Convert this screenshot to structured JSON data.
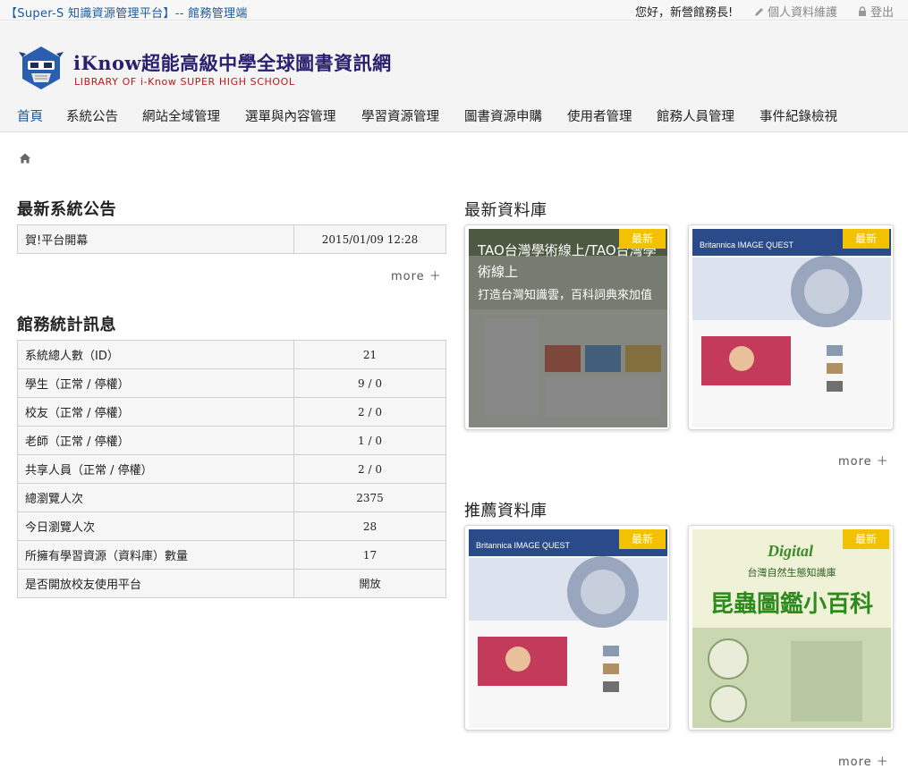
{
  "topbar": {
    "platform": "【Super-S 知識資源管理平台】-- 館務管理端",
    "greeting": "您好，新營館務長!",
    "profile_link": "個人資料維護",
    "logout_link": "登出"
  },
  "header": {
    "title": "iKnow超能高級中學全球圖書資訊網",
    "subtitle": "LIBRARY OF i-Know SUPER HIGH SCHOOL"
  },
  "nav": {
    "items": [
      "首頁",
      "系統公告",
      "網站全域管理",
      "選單與內容管理",
      "學習資源管理",
      "圖書資源申購",
      "使用者管理",
      "館務人員管理",
      "事件紀錄檢視"
    ],
    "active": "首頁"
  },
  "announcements": {
    "title": "最新系統公告",
    "rows": [
      {
        "label": "賀!平台開幕",
        "value": "2015/01/09 12:28"
      }
    ],
    "more": "more ＋"
  },
  "stats": {
    "title": "館務統計訊息",
    "rows": [
      {
        "label": "系統總人數（ID）",
        "value": "21"
      },
      {
        "label": "學生（正常 / 停權）",
        "value": "9 / 0"
      },
      {
        "label": "校友（正常 / 停權）",
        "value": "2 / 0"
      },
      {
        "label": "老師（正常 / 停權）",
        "value": "1 / 0"
      },
      {
        "label": "共享人員（正常 / 停權）",
        "value": "2 / 0"
      },
      {
        "label": "總瀏覽人次",
        "value": "2375"
      },
      {
        "label": "今日瀏覽人次",
        "value": "28"
      },
      {
        "label": "所擁有學習資源（資料庫）數量",
        "value": "17"
      },
      {
        "label": "是否開放校友使用平台",
        "value": "開放"
      }
    ]
  },
  "latest_db": {
    "title": "最新資料庫",
    "more": "more ＋",
    "cards": [
      {
        "badge": "最新",
        "overlay_title": "TAO台灣學術線上/TAO台灣學術線上",
        "overlay_desc": "打造台灣知識雲，百科詞典來加值"
      },
      {
        "badge": "最新",
        "image_caption": "Britannica IMAGE QUEST"
      }
    ]
  },
  "recommended_db": {
    "title": "推薦資料庫",
    "more": "more ＋",
    "cards": [
      {
        "badge": "最新",
        "image_caption": "Britannica IMAGE QUEST"
      },
      {
        "badge": "最新",
        "image_caption_top": "Digital",
        "image_caption_mid": "台灣自然生態知識庫",
        "image_caption_main": "昆蟲圖鑑小百科"
      }
    ]
  },
  "colors": {
    "accent": "#1a5aa0",
    "badge": "#f2c200",
    "subtitle": "#c01818"
  }
}
